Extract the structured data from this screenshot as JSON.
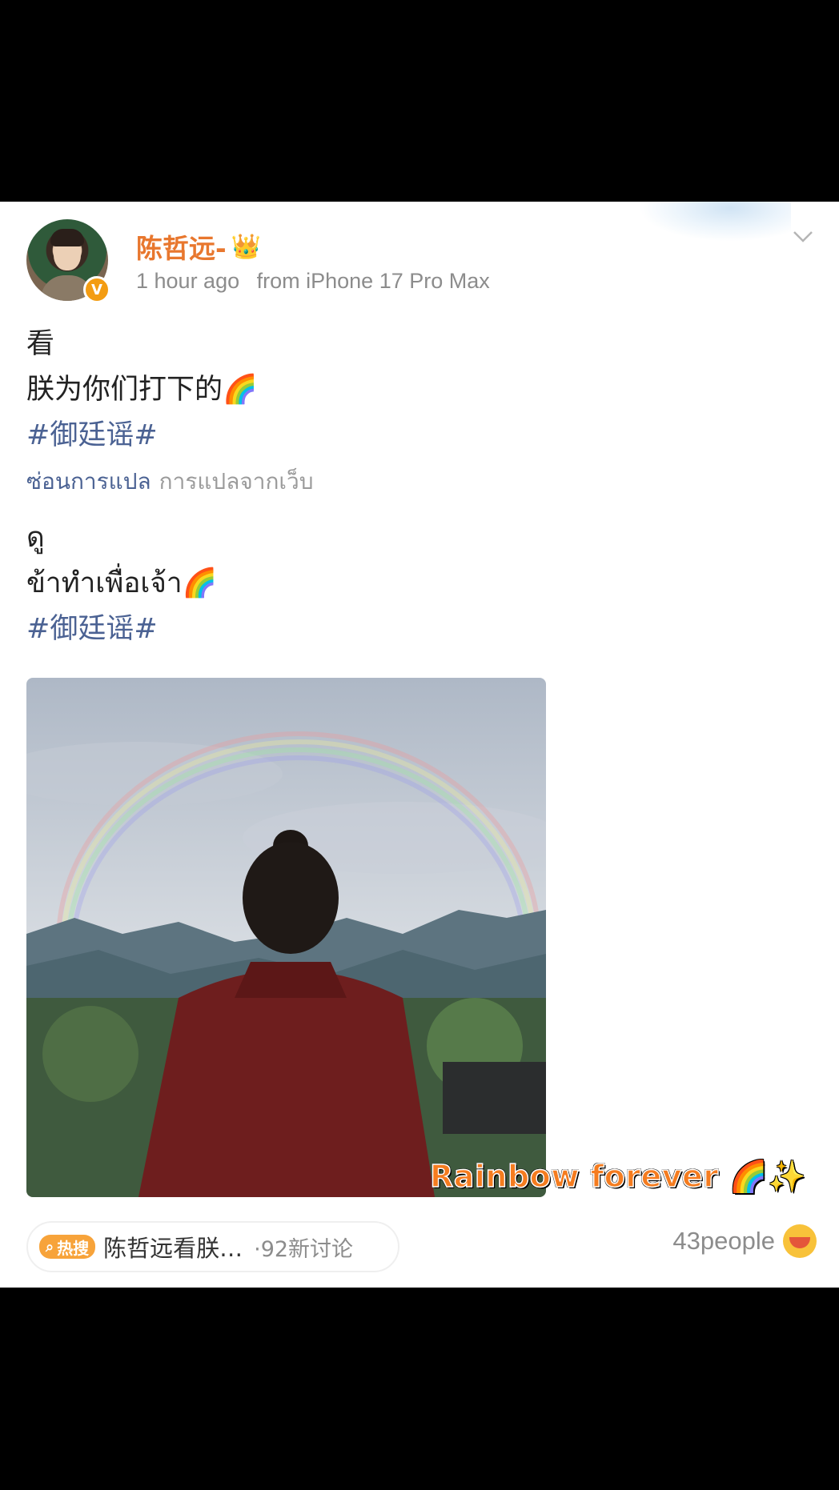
{
  "post": {
    "author": {
      "name": "陈哲远-",
      "badge_icon": "crown-icon",
      "verified_icon": "V"
    },
    "meta": {
      "time": "1 hour ago",
      "source": "from iPhone 17 Pro Max"
    },
    "text": {
      "line1": "看",
      "line2": "朕为你们打下的",
      "line2_emoji": "🌈",
      "hashtag": "#御廷谣#"
    },
    "translation": {
      "toggle_label": "ซ่อนการแปล",
      "source_label": "การแปลจากเว็บ",
      "line1": "ดู",
      "line2": "ข้าทำเพื่อเจ้า",
      "line2_emoji": "🌈",
      "hashtag": "#御廷谣#"
    },
    "image": {
      "overlay_caption": "Rainbow forever 🌈✨"
    },
    "hot_search": {
      "badge": "热搜",
      "topic": "陈哲远看朕…",
      "count": "·92新讨论"
    },
    "likes": {
      "count": "43people"
    }
  },
  "colors": {
    "username": "#e8772e",
    "hashtag": "#4b6293",
    "hot_badge": "#f7a33a",
    "meta": "#8c8c8c"
  }
}
